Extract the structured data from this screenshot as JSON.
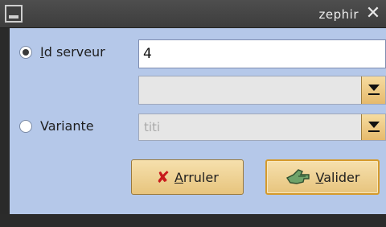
{
  "window": {
    "title": "zephir",
    "menu_icon": "window-menu-icon",
    "close_icon": "close-icon"
  },
  "form": {
    "id_serveur": {
      "label_first": "I",
      "label_rest": "d serveur",
      "value": "4",
      "selected": true
    },
    "combo1": {
      "value": ""
    },
    "variante": {
      "label": "Variante",
      "selected": false,
      "value": "titi"
    }
  },
  "buttons": {
    "cancel": {
      "label_first": "A",
      "label_rest": "rruler",
      "icon": "cancel-x-icon"
    },
    "ok": {
      "label_first": "V",
      "label_rest": "alider",
      "icon": "validate-icon"
    }
  },
  "colors": {
    "panel": "#b5c8e9",
    "titlebar": "#3d3d3d",
    "button": "#f6e0ad",
    "default_button_border": "#d59a2b"
  }
}
